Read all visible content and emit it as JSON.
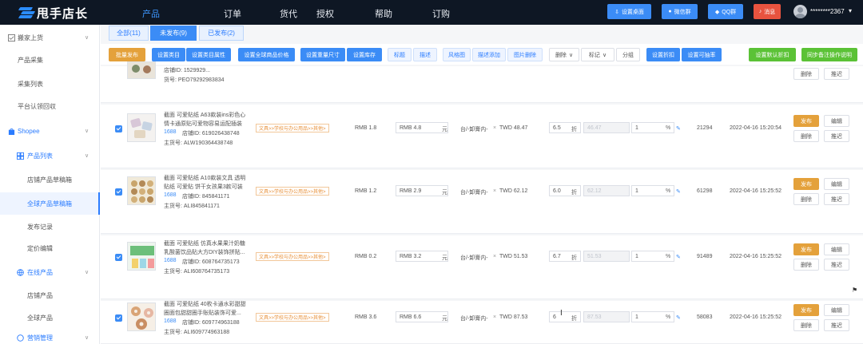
{
  "app": {
    "title": "甩手店长",
    "nav": [
      "产品",
      "订单",
      "货代",
      "授权",
      "帮助",
      "订购"
    ],
    "top_buttons": [
      "设置桌面",
      "微信群",
      "QQ群",
      "消息"
    ],
    "username": "********2367"
  },
  "sidebar": {
    "items": [
      {
        "label": "搬家上货",
        "caret": "∨"
      },
      {
        "label": "产品采集"
      },
      {
        "label": "采集列表"
      },
      {
        "label": "平台认领回収"
      },
      {
        "label": "Shopee",
        "caret": "∨"
      },
      {
        "label": "产品列表",
        "caret": "∨"
      },
      {
        "label": "店铺产品草稿箱"
      },
      {
        "label": "全球产品草稿箱"
      },
      {
        "label": "发布记录"
      },
      {
        "label": "定价编辑"
      },
      {
        "label": "在线产品",
        "caret": "∨"
      },
      {
        "label": "店铺产品"
      },
      {
        "label": "全球产品"
      },
      {
        "label": "营销管理",
        "caret": "∨"
      }
    ]
  },
  "tabs": [
    "全部(11)",
    "未发布(9)",
    "已发布(2)"
  ],
  "toolbar": [
    "批量发布",
    "设置类目",
    "设置类目属性",
    "设置全球商品价格",
    "设置重量尺寸",
    "设置库存",
    "标题",
    "描述",
    "风格图",
    "描述添加",
    "图片删除",
    "删除",
    "标记",
    "分组",
    "设置折扣",
    "设置可抽率",
    "设置默认折扣",
    "同步备注操作说明"
  ],
  "partial_row": {
    "line1": "店铺ID: 1529929...",
    "line2": "货号: PEO79292983834",
    "actions": [
      "删除",
      "推迟"
    ]
  },
  "rows": [
    {
      "title_l1": "截面 可爱贴纸 A63款装ins彩色心",
      "title_l2": "情卡通原贴可爱物容易运配插装",
      "prefix": "1688",
      "store_id": "店铺ID: 619026438748",
      "sku": "主货号: ALW190364438748",
      "category": "文具>>学校与办公用品>>其他>",
      "rmb_label": "RMB 1.8",
      "cost": "RMB 4.8",
      "unit": "元",
      "weight": "台/-卸膏内-",
      "twd": "TWD 48.47",
      "discount": "6.5",
      "disc_unit": "折",
      "mid": "46.47",
      "qty": "1",
      "pct": "%",
      "stock": "21294",
      "time": "2022-04-16 15:20:54",
      "actions": [
        "发布",
        "编辑",
        "删除",
        "推迟"
      ]
    },
    {
      "title_l1": "截面 可爱贴纸 A10款装文具 透明",
      "title_l2": "贴纸 可爱贴 饼干女孩果3款可装",
      "prefix": "1688",
      "store_id": "店铺ID: 845841171",
      "sku": "主货号: ALI845841171",
      "category": "文具>>学校与办公用品>>其他>",
      "rmb_label": "RMB 1.2",
      "cost": "RMB 2.9",
      "unit": "元",
      "weight": "台/-卸膏内-",
      "twd": "TWD 62.12",
      "discount": "6.0",
      "disc_unit": "折",
      "mid": "62.12",
      "qty": "1",
      "pct": "%",
      "stock": "61298",
      "time": "2022-04-16 15:25:52",
      "actions": [
        "发布",
        "编辑",
        "删除",
        "推迟"
      ]
    },
    {
      "title_l1": "截面 可爱贴纸 仿真水果果汁奶糖",
      "title_l2": "乳酸菌饮品贴大方DIY装饰拼贴...",
      "prefix": "1688",
      "store_id": "店铺ID: 608764735173",
      "sku": "主货号: ALI608764735173",
      "category": "文具>>学校与办公用品>>其他>",
      "rmb_label": "RMB 0.2",
      "cost": "RMB 3.2",
      "unit": "元",
      "weight": "台/-卸膏内-",
      "twd": "TWD 51.53",
      "discount": "6.7",
      "disc_unit": "折",
      "mid": "51.53",
      "qty": "1",
      "pct": "%",
      "stock": "91489",
      "time": "2022-04-16 15:25:52",
      "actions": [
        "发布",
        "编辑",
        "删除",
        "推迟"
      ]
    },
    {
      "title_l1": "截面 可爱贴纸 40枚卡通水彩甜甜",
      "title_l2": "圈面包甜甜圈手账贴装饰可爱...",
      "prefix": "1688",
      "store_id": "店铺ID: 609774963188",
      "sku": "主货号: ALI609774963188",
      "category": "文具>>学校与办公用品>>其他>",
      "rmb_label": "RMB 3.6",
      "cost": "RMB 6.6",
      "unit": "元",
      "weight": "台/-卸膏内-",
      "twd": "TWD 87.53",
      "discount": "6",
      "disc_unit": "折",
      "mid": "87.53",
      "qty": "1",
      "pct": "%",
      "stock": "58083",
      "time": "2022-04-16 15:25:52",
      "actions": [
        "发布",
        "编辑",
        "删除",
        "推迟"
      ]
    }
  ],
  "colors": {
    "topbar": "#0e1724",
    "accent": "#3b8cf6",
    "publish": "#e4a13b",
    "green": "#5bc236",
    "red": "#e8533f"
  }
}
